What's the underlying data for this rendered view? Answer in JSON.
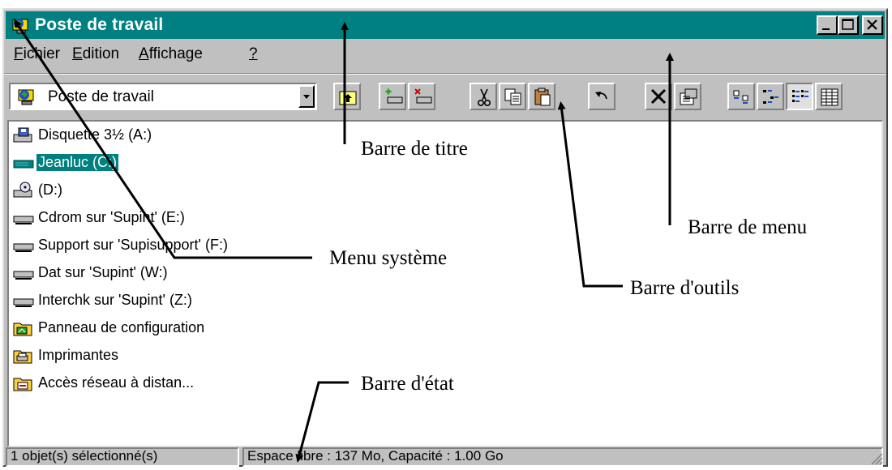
{
  "window": {
    "title": "Poste de travail"
  },
  "menu": {
    "items": [
      {
        "underline": "F",
        "rest": "ichier"
      },
      {
        "underline": "E",
        "rest": "dition"
      },
      {
        "underline": "A",
        "rest": "ffichage"
      },
      {
        "underline": "?",
        "rest": ""
      }
    ]
  },
  "toolbar": {
    "address_value": "Poste de travail",
    "buttons": [
      "up-folder-icon",
      "map-drive-icon",
      "disconnect-drive-icon",
      "cut-icon",
      "copy-icon",
      "paste-icon",
      "undo-icon",
      "delete-icon",
      "properties-icon",
      "large-icons-icon",
      "small-icons-icon",
      "list-icon",
      "details-icon"
    ],
    "pressed": "list-icon"
  },
  "items": [
    {
      "label": "Disquette 3½ (A:)",
      "icon": "floppy-drive-icon",
      "selected": false
    },
    {
      "label": "Jeanluc (C:)",
      "icon": "hard-drive-icon",
      "selected": true
    },
    {
      "label": "(D:)",
      "icon": "cd-drive-icon",
      "selected": false
    },
    {
      "label": "Cdrom sur 'Supint' (E:)",
      "icon": "network-drive-icon",
      "selected": false
    },
    {
      "label": "Support sur 'Supisupport' (F:)",
      "icon": "network-drive-icon",
      "selected": false
    },
    {
      "label": "Dat sur 'Supint' (W:)",
      "icon": "network-drive-icon",
      "selected": false
    },
    {
      "label": "Interchk sur 'Supint' (Z:)",
      "icon": "network-drive-icon",
      "selected": false
    },
    {
      "label": "Panneau de configuration",
      "icon": "control-panel-folder-icon",
      "selected": false
    },
    {
      "label": "Imprimantes",
      "icon": "printers-folder-icon",
      "selected": false
    },
    {
      "label": "Accès réseau à distan...",
      "icon": "dialup-folder-icon",
      "selected": false
    }
  ],
  "status": {
    "selection": "1 objet(s) sélectionné(s)",
    "space": "Espace libre : 137 Mo,  Capacité : 1.00 Go"
  },
  "annotations": {
    "title_bar": "Barre de titre",
    "menu_bar": "Barre de menu",
    "system_menu": "Menu système",
    "toolbar": "Barre d'outils",
    "status_bar": "Barre d'état"
  },
  "colors": {
    "titlebar": "#008080",
    "selection": "#008080",
    "chrome": "#c0c0c0"
  }
}
